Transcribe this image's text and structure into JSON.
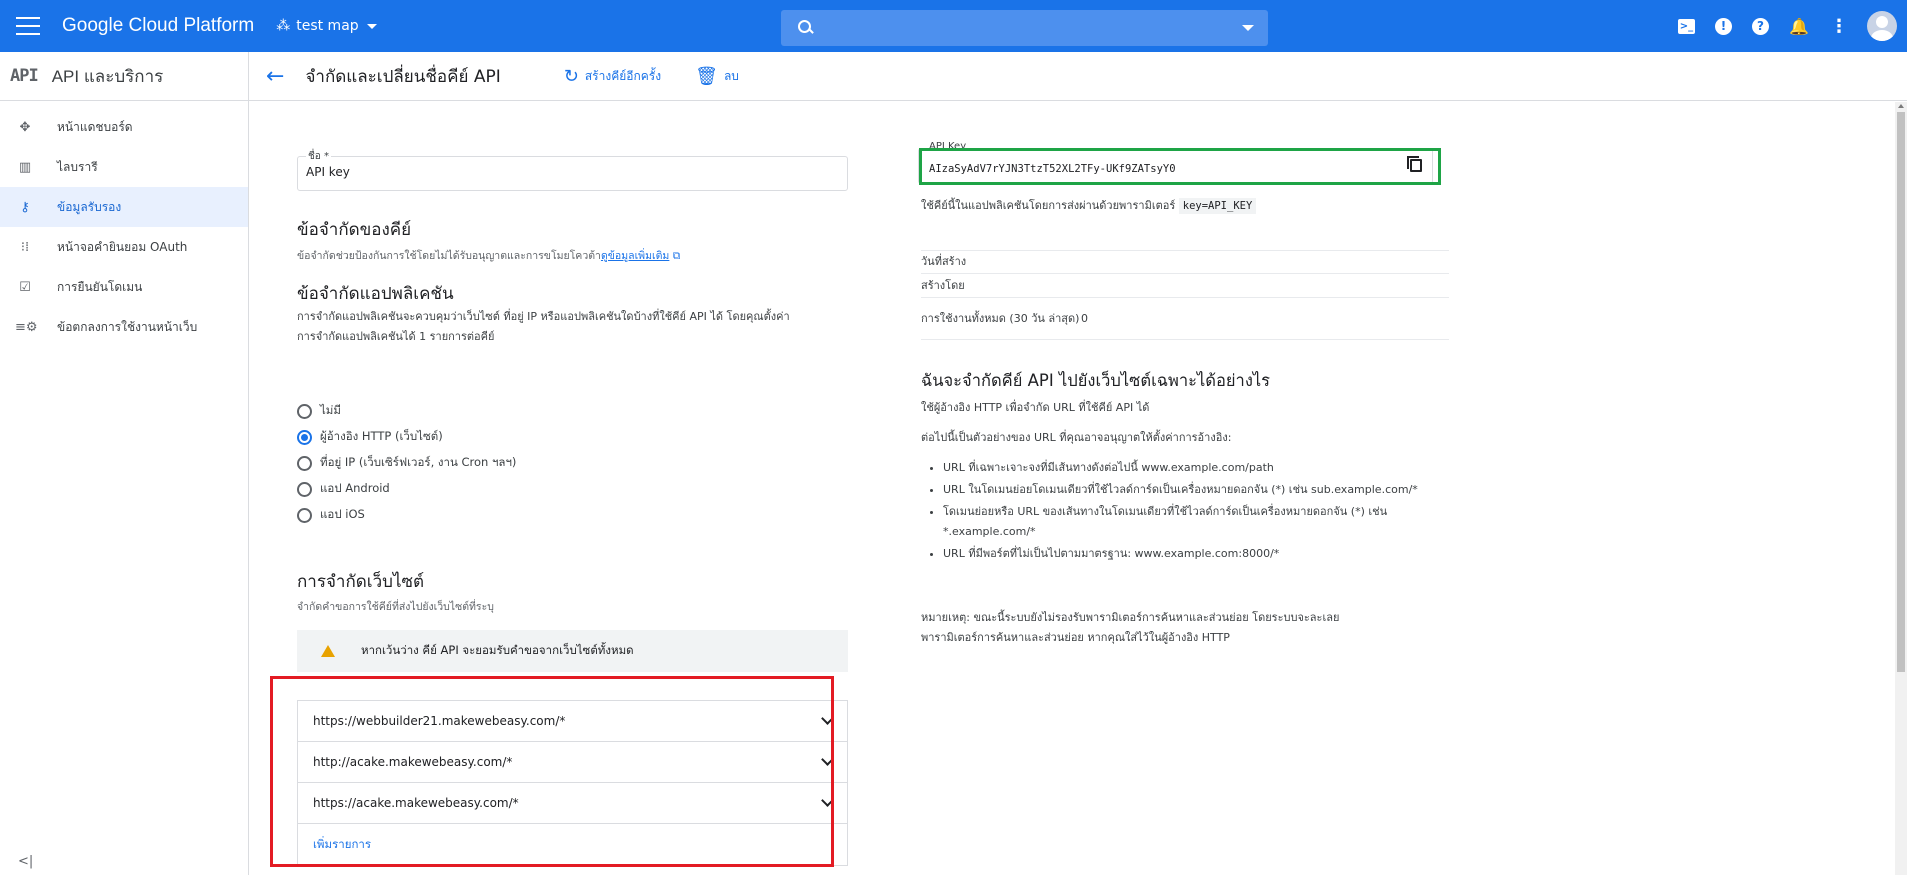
{
  "topbar": {
    "brand": "Google Cloud Platform",
    "project": "test map",
    "search_placeholder": "",
    "icons": [
      "menu-icon",
      "terminal-icon",
      "feedback-icon",
      "help-icon",
      "bell-icon",
      "more-vert-icon",
      "avatar"
    ]
  },
  "sidebar": {
    "logo": "API",
    "title": "API และบริการ",
    "items": [
      {
        "label": "หน้าแดชบอร์ด",
        "icon": "dashboard-icon",
        "active": false
      },
      {
        "label": "ไลบรารี",
        "icon": "library-icon",
        "active": false
      },
      {
        "label": "ข้อมูลรับรอง",
        "icon": "key-icon",
        "active": true
      },
      {
        "label": "หน้าจอคำยินยอม OAuth",
        "icon": "consent-icon",
        "active": false
      },
      {
        "label": "การยืนยันโดเมน",
        "icon": "checkbox-icon",
        "active": false
      },
      {
        "label": "ข้อตกลงการใช้งานหน้าเว็บ",
        "icon": "settings-list-icon",
        "active": false
      }
    ],
    "collapse": "<|"
  },
  "header": {
    "title": "จำกัดและเปลี่ยนชื่อคีย์ API",
    "regenerate": "สร้างคีย์อีกครั้ง",
    "delete": "ลบ"
  },
  "form": {
    "name_label": "ชื่อ *",
    "name_value": "API key",
    "key_restrictions_title": "ข้อจำกัดของคีย์",
    "key_restrictions_desc": "ข้อจำกัดช่วยป้องกันการใช้โดยไม่ได้รับอนุญาตและการขโมยโควต้า",
    "learn_more": "ดูข้อมูลเพิ่มเติม",
    "app_restrictions_title": "ข้อจำกัดแอปพลิเคชัน",
    "app_restrictions_desc_1": "การจำกัดแอปพลิเคชันจะควบคุมว่าเว็บไซต์ ที่อยู่ IP หรือแอปพลิเคชันใดบ้างที่ใช้คีย์ API ได้ โดยคุณตั้งค่า",
    "app_restrictions_desc_2": "การจำกัดแอปพลิเคชันได้ 1 รายการต่อคีย์",
    "radios": [
      {
        "label": "ไม่มี",
        "checked": false
      },
      {
        "label": "ผู้อ้างอิง HTTP (เว็บไซต์)",
        "checked": true
      },
      {
        "label": "ที่อยู่ IP (เว็บเซิร์ฟเวอร์, งาน Cron ฯลฯ)",
        "checked": false
      },
      {
        "label": "แอป Android",
        "checked": false
      },
      {
        "label": "แอป iOS",
        "checked": false
      }
    ],
    "website_title": "การจำกัดเว็บไซต์",
    "website_desc": "จำกัดคำขอการใช้คีย์ที่ส่งไปยังเว็บไซต์ที่ระบุ",
    "warning": "หากเว้นว่าง คีย์ API จะยอมรับคำขอจากเว็บไซต์ทั้งหมด",
    "urls": [
      "https://webbuilder21.makewebeasy.com/*",
      "http://acake.makewebeasy.com/*",
      "https://acake.makewebeasy.com/*"
    ],
    "add_item": "เพิ่มรายการ"
  },
  "right": {
    "api_key_label": "API Key",
    "api_key_value": "AIzaSyAdV7rYJN3TtzT52XL2TFy-UKf9ZATsyY0",
    "usage_text": "ใช้คีย์นี้ในแอปพลิเคชันโดยการส่งผ่านด้วยพารามิเตอร์",
    "usage_code": "key=API_KEY",
    "info_rows": [
      {
        "k": "วันที่สร้าง",
        "v": ""
      },
      {
        "k": "สร้างโดย",
        "v": ""
      },
      {
        "k": "การใช้งานทั้งหมด (30 วัน ล่าสุด)",
        "v": "0"
      }
    ],
    "how_title": "ฉันจะจำกัดคีย์ API ไปยังเว็บไซต์เฉพาะได้อย่างไร",
    "how_desc": "ใช้ผู้อ้างอิง HTTP เพื่อจำกัด URL ที่ใช้คีย์ API ได้",
    "examples_intro": "ต่อไปนี้เป็นตัวอย่างของ URL ที่คุณอาจอนุญาตให้ตั้งค่าการอ้างอิง:",
    "bullets": [
      "URL ที่เฉพาะเจาะจงที่มีเส้นทางดังต่อไปนี้ www.example.com/path",
      "URL ในโดเมนย่อยโดเมนเดียวที่ใช้ไวลด์การ์ดเป็นเครื่องหมายดอกจัน (*) เช่น sub.example.com/*",
      "โดเมนย่อยหรือ URL ของเส้นทางในโดเมนเดียวที่ใช้ไวลด์การ์ดเป็นเครื่องหมายดอกจัน (*) เช่น *.example.com/*",
      "URL ที่มีพอร์ตที่ไม่เป็นไปตามมาตรฐาน: www.example.com:8000/*"
    ],
    "note_1": "หมายเหตุ: ขณะนี้ระบบยังไม่รองรับพารามิเตอร์การค้นหาและส่วนย่อย โดยระบบจะละเลย",
    "note_2": "พารามิเตอร์การค้นหาและส่วนย่อย หากคุณใส่ไว้ในผู้อ้างอิง HTTP"
  },
  "colors": {
    "topbar": "#1a73e8",
    "link": "#1a73e8",
    "highlight_red": "#e31b23",
    "highlight_green": "#1ea446"
  }
}
